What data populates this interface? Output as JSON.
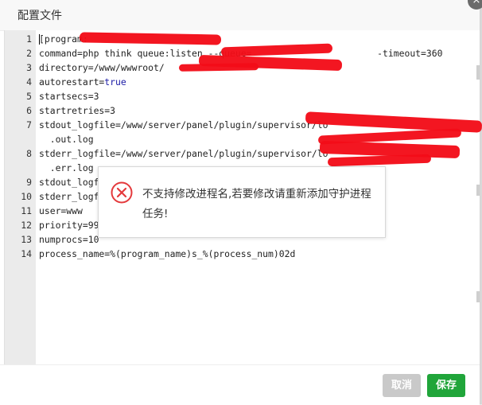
{
  "dialog": {
    "title": "配置文件",
    "close_glyph": "×"
  },
  "editor": {
    "lines": [
      {
        "no": "1",
        "text": "[program:"
      },
      {
        "no": "2",
        "text": "command=php think queue:listen --queue=                       -timeout=360"
      },
      {
        "no": "3",
        "text": "directory=/www/wwwroot/"
      },
      {
        "no": "4",
        "text_key": "autorestart=",
        "value": "true"
      },
      {
        "no": "5",
        "text": "startsecs=3"
      },
      {
        "no": "6",
        "text": "startretries=3"
      },
      {
        "no": "7",
        "text": "stdout_logfile=/www/server/panel/plugin/supervisor/lo"
      },
      {
        "no": "",
        "text": "  .out.log"
      },
      {
        "no": "8",
        "text": "stderr_logfile=/www/server/panel/plugin/supervisor/lo"
      },
      {
        "no": "",
        "text": "  .err.log"
      },
      {
        "no": "9",
        "text": "stdout_logfi"
      },
      {
        "no": "10",
        "text": "stderr_logfi"
      },
      {
        "no": "11",
        "text": "user=www"
      },
      {
        "no": "12",
        "text": "priority=999"
      },
      {
        "no": "13",
        "text": "numprocs=10"
      },
      {
        "no": "14",
        "text": "process_name=%(program_name)s_%(process_num)02d"
      }
    ]
  },
  "toast": {
    "icon": "error-circle-icon",
    "message": "不支持修改进程名,若要修改请重新添加守护进程任务!"
  },
  "footer": {
    "cancel_label": "取消",
    "save_label": "保存"
  },
  "colors": {
    "save_green": "#20a53a",
    "cancel_gray": "#c9c9c9",
    "error_red": "#e4393c",
    "redaction_red": "#f20d18"
  }
}
